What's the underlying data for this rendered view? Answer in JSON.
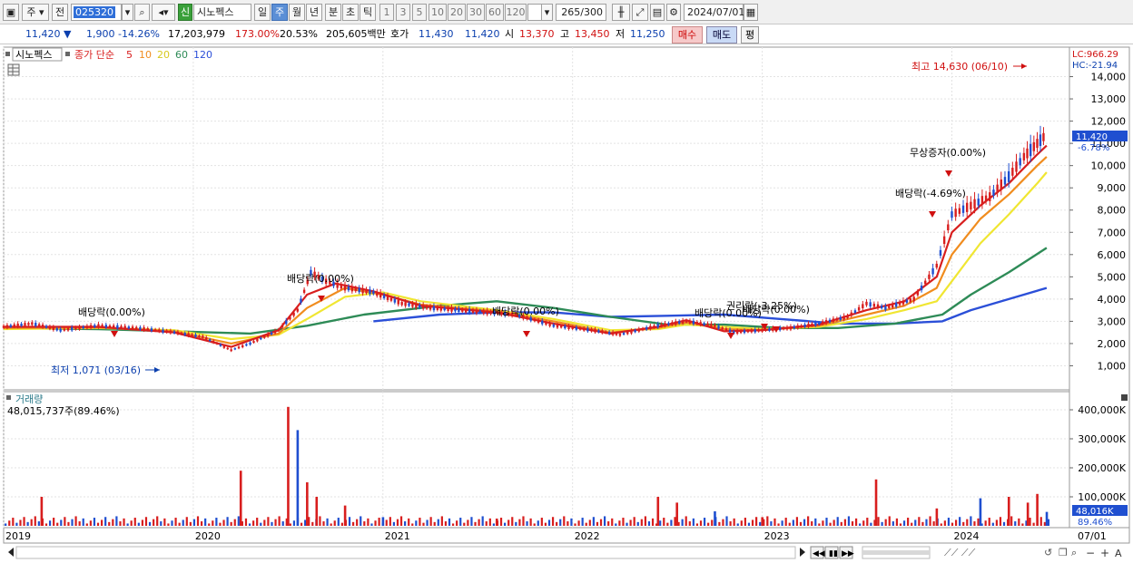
{
  "toolbar": {
    "market": "주",
    "prev_label": "전",
    "code": "025320",
    "badge": "신",
    "name": "시노펙스",
    "periods": [
      "일",
      "주",
      "월",
      "년",
      "분",
      "초",
      "틱"
    ],
    "active_period": "주",
    "intervals": [
      "1",
      "3",
      "5",
      "10",
      "20",
      "30",
      "60",
      "120"
    ],
    "count": "265",
    "count_total": "/300",
    "date": "2024/07/01"
  },
  "quote": {
    "price": "11,420",
    "arrow": "▼",
    "change": "1,900",
    "change_pct": "-14.26%",
    "volume": "17,203,979",
    "vol_ratio": "173.00%",
    "turnover": "20.53%",
    "amount": "205,605백만",
    "ask_label": "호가",
    "ask": "11,430",
    "bid": "11,420",
    "open_label": "시",
    "open": "13,370",
    "high_label": "고",
    "high": "13,450",
    "low_label": "저",
    "low": "11,250",
    "buy_label": "매수",
    "sell_label": "매도",
    "eval_label": "평"
  },
  "legend": {
    "name": "시노펙스",
    "ma_label": "종가 단순",
    "ma_periods": [
      "5",
      "10",
      "20",
      "60",
      "120"
    ],
    "ma_colors": [
      "#d81e1e",
      "#f08c1e",
      "#f0e632",
      "#2e8b57",
      "#2b4fd8"
    ]
  },
  "right_badges": {
    "lc": "LC:966.29",
    "hc": "HC:-21.94",
    "price": "11,420",
    "price_pct": "-6.78%",
    "vol": "48,016K",
    "vol_pct": "89.46%"
  },
  "annotations": {
    "high": "최고 14,630 (06/10)",
    "low": "최저 1,071 (03/16)",
    "events": [
      "배당락(0.00%)",
      "배당락(0.00%)",
      "배당락(0.00%)",
      "배당락(0.00%)",
      "권리락(-3.25%)",
      "배당락(0.00%)",
      "무상증자(0.00%)",
      "배당락(-4.69%)"
    ]
  },
  "volume_panel": {
    "title": "거래량",
    "summary": "48,015,737주(89.46%)"
  },
  "chart_data": {
    "type": "line",
    "price_axis": {
      "ticks": [
        1000,
        2000,
        3000,
        4000,
        5000,
        6000,
        7000,
        8000,
        9000,
        10000,
        11000,
        12000,
        13000,
        14000
      ],
      "tick_labels": [
        "1,000",
        "2,000",
        "3,000",
        "4,000",
        "5,000",
        "6,000",
        "7,000",
        "8,000",
        "9,000",
        "10,000",
        "11,000",
        "12,000",
        "13,000",
        "14,000"
      ]
    },
    "volume_axis": {
      "ticks": [
        100000,
        200000,
        300000,
        400000
      ],
      "tick_labels": [
        "100,000K",
        "200,000K",
        "300,000K",
        "400,000K"
      ]
    },
    "x_labels": [
      "2019",
      "2020",
      "2021",
      "2022",
      "2023",
      "2024",
      "07/01"
    ],
    "x_label_years": [
      2019.0,
      2020.0,
      2021.0,
      2022.0,
      2023.0,
      2024.0,
      2024.5
    ],
    "price_series": [
      [
        2019.0,
        2750
      ],
      [
        2019.15,
        2900
      ],
      [
        2019.3,
        2600
      ],
      [
        2019.5,
        2800
      ],
      [
        2019.7,
        2700
      ],
      [
        2019.9,
        2500
      ],
      [
        2020.05,
        2300
      ],
      [
        2020.2,
        1700
      ],
      [
        2020.3,
        2000
      ],
      [
        2020.45,
        2600
      ],
      [
        2020.55,
        3500
      ],
      [
        2020.62,
        5200
      ],
      [
        2020.7,
        4800
      ],
      [
        2020.8,
        4500
      ],
      [
        2020.95,
        4300
      ],
      [
        2021.1,
        3800
      ],
      [
        2021.25,
        3600
      ],
      [
        2021.4,
        3500
      ],
      [
        2021.55,
        3400
      ],
      [
        2021.7,
        3300
      ],
      [
        2021.9,
        2800
      ],
      [
        2022.1,
        2600
      ],
      [
        2022.25,
        2400
      ],
      [
        2022.45,
        2800
      ],
      [
        2022.6,
        3000
      ],
      [
        2022.75,
        2800
      ],
      [
        2022.85,
        2500
      ],
      [
        2023.0,
        2600
      ],
      [
        2023.15,
        2700
      ],
      [
        2023.3,
        2900
      ],
      [
        2023.45,
        3200
      ],
      [
        2023.55,
        3800
      ],
      [
        2023.65,
        3600
      ],
      [
        2023.8,
        4000
      ],
      [
        2023.92,
        5500
      ],
      [
        2024.0,
        7800
      ],
      [
        2024.1,
        8200
      ],
      [
        2024.2,
        8600
      ],
      [
        2024.3,
        9500
      ],
      [
        2024.38,
        10400
      ],
      [
        2024.45,
        11000
      ],
      [
        2024.5,
        11420
      ]
    ],
    "ma_series": [
      {
        "name": "5",
        "color": "#d81e1e",
        "values": [
          [
            2019.0,
            2750
          ],
          [
            2019.5,
            2750
          ],
          [
            2019.9,
            2500
          ],
          [
            2020.2,
            1850
          ],
          [
            2020.45,
            2600
          ],
          [
            2020.6,
            4200
          ],
          [
            2020.75,
            4700
          ],
          [
            2020.95,
            4350
          ],
          [
            2021.2,
            3700
          ],
          [
            2021.6,
            3400
          ],
          [
            2021.9,
            2900
          ],
          [
            2022.2,
            2450
          ],
          [
            2022.45,
            2750
          ],
          [
            2022.6,
            3050
          ],
          [
            2022.8,
            2550
          ],
          [
            2023.0,
            2600
          ],
          [
            2023.3,
            2850
          ],
          [
            2023.55,
            3500
          ],
          [
            2023.75,
            3900
          ],
          [
            2023.92,
            5000
          ],
          [
            2024.0,
            7000
          ],
          [
            2024.15,
            8200
          ],
          [
            2024.3,
            9200
          ],
          [
            2024.45,
            10500
          ],
          [
            2024.5,
            10900
          ]
        ]
      },
      {
        "name": "10",
        "color": "#f08c1e",
        "values": [
          [
            2019.0,
            2700
          ],
          [
            2019.5,
            2720
          ],
          [
            2019.9,
            2550
          ],
          [
            2020.2,
            2000
          ],
          [
            2020.45,
            2450
          ],
          [
            2020.6,
            3600
          ],
          [
            2020.8,
            4500
          ],
          [
            2021.0,
            4200
          ],
          [
            2021.2,
            3750
          ],
          [
            2021.6,
            3450
          ],
          [
            2021.9,
            3000
          ],
          [
            2022.2,
            2500
          ],
          [
            2022.45,
            2700
          ],
          [
            2022.6,
            2950
          ],
          [
            2022.8,
            2650
          ],
          [
            2023.0,
            2600
          ],
          [
            2023.3,
            2800
          ],
          [
            2023.55,
            3300
          ],
          [
            2023.75,
            3700
          ],
          [
            2023.92,
            4500
          ],
          [
            2024.0,
            6000
          ],
          [
            2024.15,
            7600
          ],
          [
            2024.3,
            8700
          ],
          [
            2024.45,
            10000
          ],
          [
            2024.5,
            10400
          ]
        ]
      },
      {
        "name": "20",
        "color": "#f0e632",
        "values": [
          [
            2019.0,
            2650
          ],
          [
            2019.5,
            2700
          ],
          [
            2019.9,
            2600
          ],
          [
            2020.2,
            2200
          ],
          [
            2020.45,
            2400
          ],
          [
            2020.6,
            3100
          ],
          [
            2020.8,
            4100
          ],
          [
            2021.0,
            4300
          ],
          [
            2021.2,
            3900
          ],
          [
            2021.6,
            3500
          ],
          [
            2021.9,
            3100
          ],
          [
            2022.2,
            2600
          ],
          [
            2022.45,
            2650
          ],
          [
            2022.6,
            2850
          ],
          [
            2022.8,
            2750
          ],
          [
            2023.0,
            2650
          ],
          [
            2023.3,
            2750
          ],
          [
            2023.55,
            3100
          ],
          [
            2023.75,
            3500
          ],
          [
            2023.92,
            3900
          ],
          [
            2024.0,
            4800
          ],
          [
            2024.15,
            6500
          ],
          [
            2024.3,
            7800
          ],
          [
            2024.45,
            9200
          ],
          [
            2024.5,
            9700
          ]
        ]
      },
      {
        "name": "60",
        "color": "#2e8b57",
        "values": [
          [
            2019.0,
            2700
          ],
          [
            2019.5,
            2650
          ],
          [
            2019.9,
            2550
          ],
          [
            2020.3,
            2450
          ],
          [
            2020.6,
            2800
          ],
          [
            2020.9,
            3300
          ],
          [
            2021.3,
            3700
          ],
          [
            2021.6,
            3900
          ],
          [
            2021.9,
            3600
          ],
          [
            2022.2,
            3200
          ],
          [
            2022.5,
            2850
          ],
          [
            2022.8,
            2850
          ],
          [
            2023.1,
            2700
          ],
          [
            2023.4,
            2700
          ],
          [
            2023.7,
            2900
          ],
          [
            2023.95,
            3300
          ],
          [
            2024.1,
            4200
          ],
          [
            2024.3,
            5200
          ],
          [
            2024.5,
            6300
          ]
        ]
      },
      {
        "name": "120",
        "color": "#2b4fd8",
        "values": [
          [
            2020.95,
            3000
          ],
          [
            2021.3,
            3300
          ],
          [
            2021.6,
            3400
          ],
          [
            2021.9,
            3400
          ],
          [
            2022.2,
            3200
          ],
          [
            2022.5,
            3250
          ],
          [
            2022.8,
            3300
          ],
          [
            2023.1,
            3100
          ],
          [
            2023.4,
            2900
          ],
          [
            2023.7,
            2900
          ],
          [
            2023.95,
            3000
          ],
          [
            2024.1,
            3500
          ],
          [
            2024.3,
            4000
          ],
          [
            2024.5,
            4500
          ]
        ]
      }
    ],
    "volume_series": [
      [
        2019.2,
        100000
      ],
      [
        2020.25,
        190000
      ],
      [
        2020.5,
        410000
      ],
      [
        2020.55,
        330000
      ],
      [
        2020.6,
        150000
      ],
      [
        2020.65,
        100000
      ],
      [
        2020.8,
        70000
      ],
      [
        2021.0,
        30000
      ],
      [
        2021.6,
        25000
      ],
      [
        2022.45,
        100000
      ],
      [
        2022.55,
        80000
      ],
      [
        2022.75,
        50000
      ],
      [
        2023.0,
        30000
      ],
      [
        2023.6,
        160000
      ],
      [
        2023.92,
        60000
      ],
      [
        2024.15,
        95000
      ],
      [
        2024.3,
        100000
      ],
      [
        2024.4,
        80000
      ],
      [
        2024.45,
        110000
      ],
      [
        2024.5,
        48016
      ]
    ]
  }
}
